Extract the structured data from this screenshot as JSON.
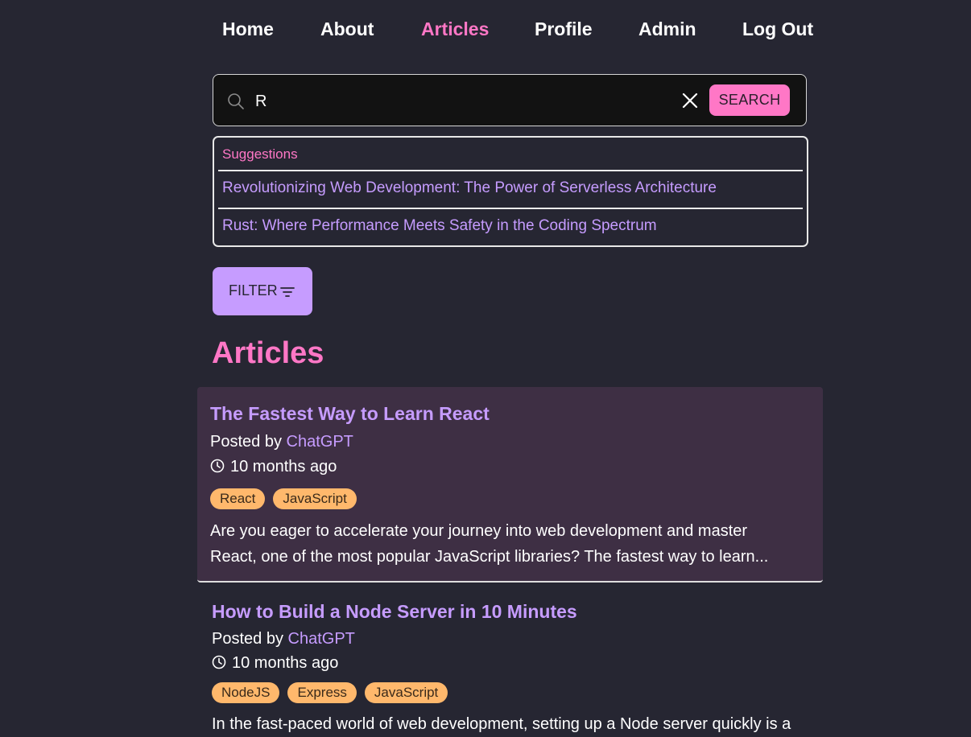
{
  "nav": {
    "items": [
      {
        "label": "Home",
        "active": false
      },
      {
        "label": "About",
        "active": false
      },
      {
        "label": "Articles",
        "active": true
      },
      {
        "label": "Profile",
        "active": false
      },
      {
        "label": "Admin",
        "active": false
      },
      {
        "label": "Log Out",
        "active": false
      }
    ]
  },
  "search": {
    "value": "R",
    "button_label": "SEARCH"
  },
  "suggestions": {
    "header": "Suggestions",
    "items": [
      "Revolutionizing Web Development: The Power of Serverless Architecture",
      "Rust: Where Performance Meets Safety in the Coding Spectrum"
    ]
  },
  "filter": {
    "label": "FILTER",
    "icon": "filter-lines-icon"
  },
  "page": {
    "title": "Articles"
  },
  "articles": [
    {
      "title": "The Fastest Way to Learn React",
      "posted_by_prefix": "Posted by",
      "author": "ChatGPT",
      "time": "10 months ago",
      "tags": [
        "React",
        "JavaScript"
      ],
      "excerpt": "Are you eager to accelerate your journey into web development and master React, one of the most popular JavaScript libraries? The fastest way to learn..."
    },
    {
      "title": "How to Build a Node Server in 10 Minutes",
      "posted_by_prefix": "Posted by",
      "author": "ChatGPT",
      "time": "10 months ago",
      "tags": [
        "NodeJS",
        "Express",
        "JavaScript"
      ],
      "excerpt": "In the fast-paced world of web development, setting up a Node server quickly is a"
    }
  ],
  "colors": {
    "background": "#262632",
    "accent_pink": "#ff77c6",
    "accent_purple": "#c69cff",
    "tag_orange": "#ffb86c",
    "highlight_card": "#3e2f44"
  }
}
